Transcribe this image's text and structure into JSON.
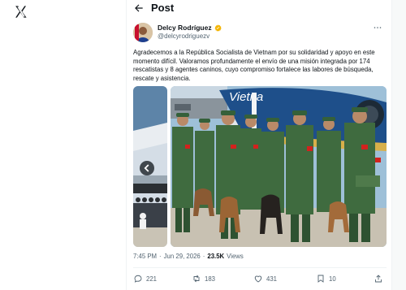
{
  "header": {
    "title": "Post"
  },
  "author": {
    "display_name": "Delcy Rodríguez",
    "handle": "@delcyrodriguezv"
  },
  "tweet": {
    "text": "Agradecemos a la República Socialista de Vietnam por su solidaridad y apoyo en este momento difícil. Valoramos profundamente el envío de una misión integrada por 174 rescatistas y 8 agentes caninos, cuyo compromiso fortalece las labores de búsqueda, rescate y asistencia."
  },
  "media": {
    "plane_livery": "Vietna"
  },
  "meta": {
    "time": "7:45 PM",
    "separator1": "·",
    "date": "Jun 29, 2026",
    "separator2": "·",
    "views_count": "23.5K",
    "views_label": "Views"
  },
  "actions": {
    "replies": "221",
    "reposts": "183",
    "likes": "431",
    "bookmarks": "10"
  },
  "colors": {
    "text": "#0f1419",
    "secondary": "#536471",
    "verified": "#f4b400",
    "uniform": "#3f6b3f"
  }
}
